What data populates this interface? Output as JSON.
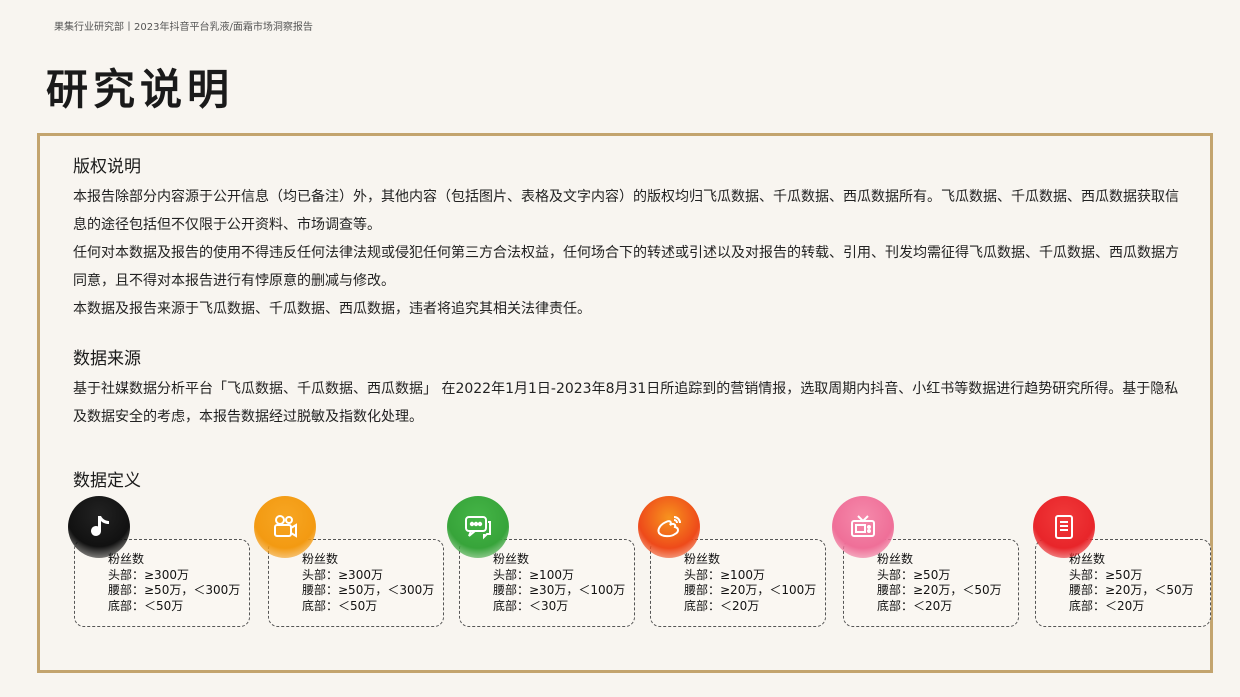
{
  "header": {
    "breadcrumb": "果集行业研究部丨2023年抖音平台乳液/面霜市场洞察报告",
    "title": "研究说明"
  },
  "copyright": {
    "title": "版权说明",
    "paragraphs": [
      "本报告除部分内容源于公开信息（均已备注）外，其他内容（包括图片、表格及文字内容）的版权均归飞瓜数据、千瓜数据、西瓜数据所有。飞瓜数据、千瓜数据、西瓜数据获取信息的途径包括但不仅限于公开资料、市场调查等。",
      "任何对本数据及报告的使用不得违反任何法律法规或侵犯任何第三方合法权益，任何场合下的转述或引述以及对报告的转载、引用、刊发均需征得飞瓜数据、千瓜数据、西瓜数据方同意，且不得对本报告进行有悖原意的删减与修改。",
      "本数据及报告来源于飞瓜数据、千瓜数据、西瓜数据，违者将追究其相关法律责任。"
    ]
  },
  "source": {
    "title": "数据来源",
    "paragraphs": [
      "基于社媒数据分析平台「飞瓜数据、千瓜数据、西瓜数据」 在2022年1月1日-2023年8月31日所追踪到的营销情报，选取周期内抖音、小红书等数据进行趋势研究所得。基于隐私及数据安全的考虑，本报告数据经过脱敏及指数化处理。"
    ]
  },
  "definition": {
    "title": "数据定义",
    "cards": [
      {
        "icon": "music-note-icon",
        "color": "#111111",
        "heading": "粉丝数",
        "head": "头部：≥300万",
        "waist": "腰部：≥50万，＜300万",
        "bottom": "底部：＜50万"
      },
      {
        "icon": "video-camera-icon",
        "color": "#f39a12",
        "heading": "粉丝数",
        "head": "头部：≥300万",
        "waist": "腰部：≥50万，＜300万",
        "bottom": "底部：＜50万"
      },
      {
        "icon": "chat-bubble-icon",
        "color": "#37a43a",
        "heading": "粉丝数",
        "head": "头部：≥100万",
        "waist": "腰部：≥30万，＜100万",
        "bottom": "底部：＜30万"
      },
      {
        "icon": "weibo-icon",
        "color": "#ee4a1a",
        "heading": "粉丝数",
        "head": "头部：≥100万",
        "waist": "腰部：≥20万，＜100万",
        "bottom": "底部：＜20万"
      },
      {
        "icon": "tv-icon",
        "color": "#ef6f98",
        "heading": "粉丝数",
        "head": "头部：≥50万",
        "waist": "腰部：≥20万，＜50万",
        "bottom": "底部：＜20万"
      },
      {
        "icon": "book-icon",
        "color": "#e8252a",
        "heading": "粉丝数",
        "head": "头部：≥50万",
        "waist": "腰部：≥20万，＜50万",
        "bottom": "底部：＜20万"
      }
    ]
  }
}
